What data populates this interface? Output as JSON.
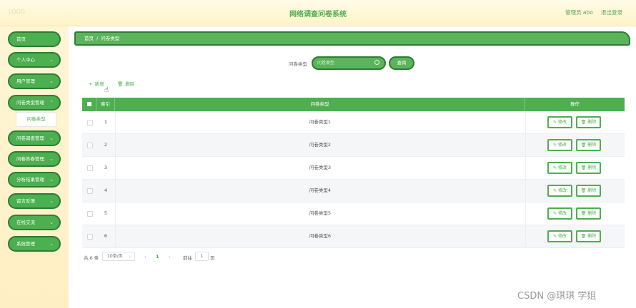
{
  "header": {
    "logo": "LOGO",
    "title": "网络调查问卷系统",
    "user": "管理员 abo",
    "logout": "退出登录"
  },
  "sidebar": {
    "items": [
      {
        "label": "首页",
        "chevron": false
      },
      {
        "label": "个人中心",
        "chevron": true
      },
      {
        "label": "用户管理",
        "chevron": true
      },
      {
        "label": "问卷类型管理",
        "chevron": true
      },
      {
        "label": "问卷调查管理",
        "chevron": true
      },
      {
        "label": "问卷答卷管理",
        "chevron": true
      },
      {
        "label": "分析结果管理",
        "chevron": true
      },
      {
        "label": "留言反馈",
        "chevron": true
      },
      {
        "label": "在线交流",
        "chevron": true
      },
      {
        "label": "系统管理",
        "chevron": true
      }
    ],
    "submenu": "问卷类型"
  },
  "breadcrumb": {
    "home": "首页",
    "separator": "/",
    "current": "问卷类型"
  },
  "search": {
    "label": "问卷类型",
    "placeholder": "问卷类型",
    "button": "查询"
  },
  "actions": {
    "add": "新增",
    "delete": "删除"
  },
  "table": {
    "columns": {
      "index": "索引",
      "type": "问卷类型",
      "ops": "操作"
    },
    "edit_label": "修改",
    "delete_label": "删除",
    "rows": [
      {
        "index": "1",
        "type": "问卷类型1"
      },
      {
        "index": "2",
        "type": "问卷类型2"
      },
      {
        "index": "3",
        "type": "问卷类型3"
      },
      {
        "index": "4",
        "type": "问卷类型4"
      },
      {
        "index": "5",
        "type": "问卷类型5"
      },
      {
        "index": "6",
        "type": "问卷类型6"
      }
    ]
  },
  "pagination": {
    "total": "共 6 条",
    "page_size": "10条/页",
    "prev": "‹",
    "current_page": "1",
    "next": "›",
    "goto_label": "前往",
    "goto_value": "1",
    "page_suffix": "页"
  },
  "watermark": "CSDN @琪琪 学姐",
  "colors": {
    "accent": "#4caf50",
    "accent_dark": "#2e7d32",
    "sidebar_bg": "#fff3c8"
  }
}
